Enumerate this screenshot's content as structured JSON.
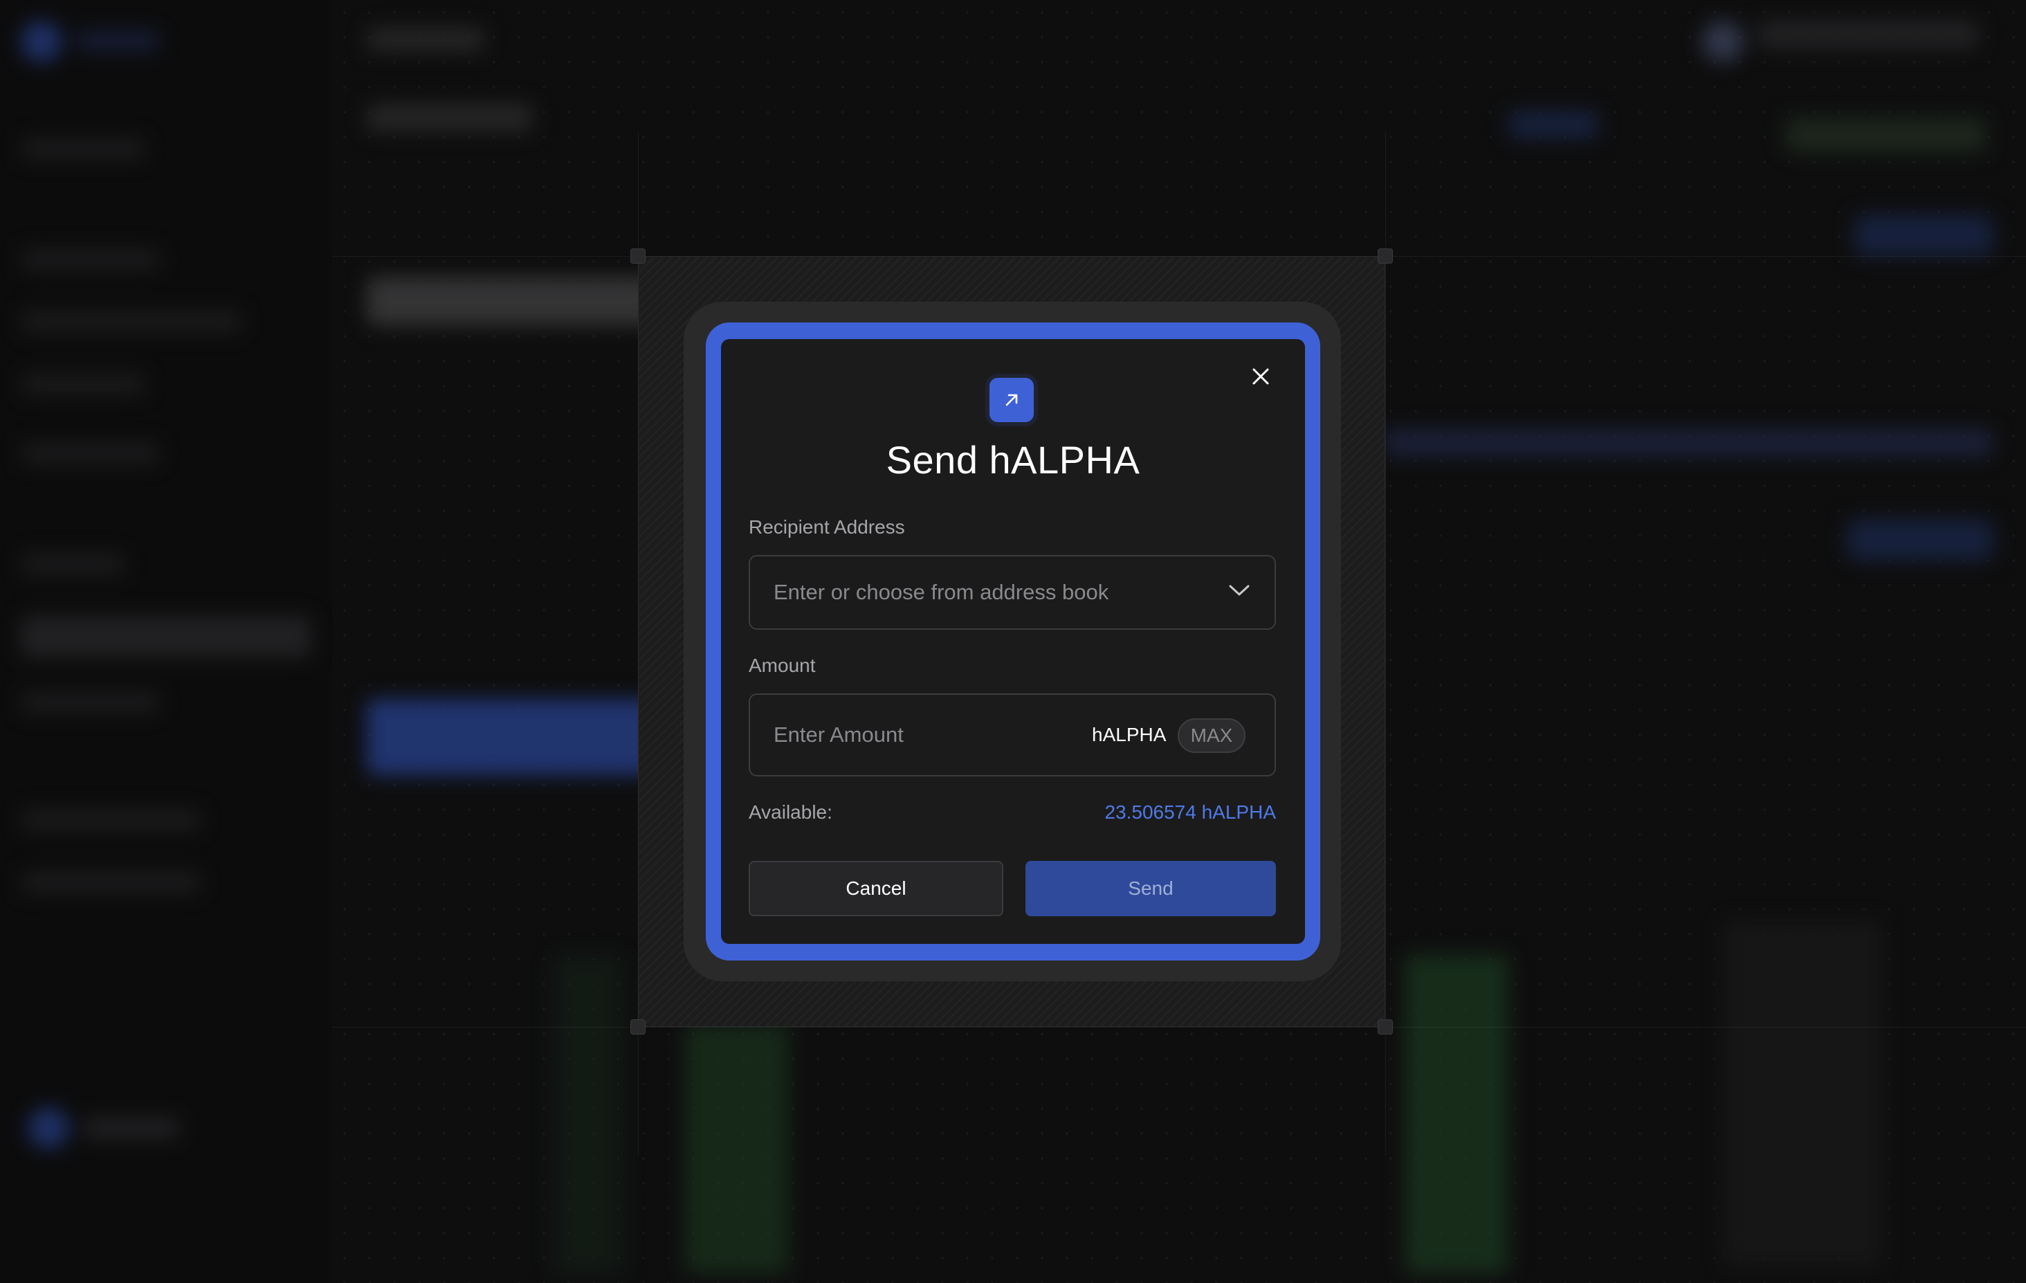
{
  "dialog": {
    "title": "Send hALPHA",
    "close_icon": "close-icon",
    "header_icon": "arrow-up-right-icon",
    "recipient": {
      "label": "Recipient Address",
      "placeholder": "Enter or choose from address book",
      "icon": "chevron-down-icon"
    },
    "amount": {
      "label": "Amount",
      "placeholder": "Enter Amount",
      "unit": "hALPHA",
      "max_label": "MAX"
    },
    "available": {
      "label": "Available:",
      "value": "23.506574 hALPHA"
    },
    "buttons": {
      "cancel": "Cancel",
      "send": "Send"
    }
  },
  "colors": {
    "accent": "#3e62d6",
    "available_value": "#4f7ae8",
    "dialog_bg": "#1b1b1c",
    "page_bg": "#161617"
  }
}
